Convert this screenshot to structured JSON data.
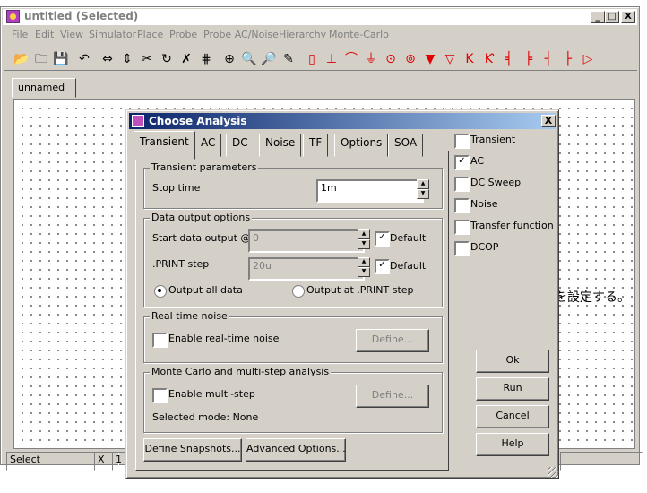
{
  "window": {
    "title": "untitled (Selected)",
    "caption_buttons": [
      "_",
      "□",
      "X"
    ]
  },
  "menu": [
    "File",
    "Edit",
    "View",
    "Simulator",
    "Place",
    "Probe",
    "Probe AC/Noise",
    "Hierarchy",
    "Monte-Carlo"
  ],
  "toolbar": {
    "items": [
      {
        "name": "open-folder-icon",
        "glyph": "📂"
      },
      {
        "name": "new-folder-icon",
        "glyph": "🗀"
      },
      {
        "name": "save-icon",
        "glyph": "💾"
      },
      {
        "name": "undo-icon",
        "glyph": "↶"
      },
      {
        "name": "mirror-icon",
        "glyph": "⇔"
      },
      {
        "name": "flip-icon",
        "glyph": "⇕"
      },
      {
        "name": "cut-icon",
        "glyph": "✂"
      },
      {
        "name": "rotate-icon",
        "glyph": "↻"
      },
      {
        "name": "delete-icon",
        "glyph": "✗"
      },
      {
        "name": "wire-icon",
        "glyph": "⋕"
      },
      {
        "name": "zoom-fit-icon",
        "glyph": "⊕"
      },
      {
        "name": "zoom-out-icon",
        "glyph": "🔍"
      },
      {
        "name": "zoom-in-icon",
        "glyph": "🔎"
      },
      {
        "name": "pencil-icon",
        "glyph": "✎"
      },
      {
        "name": "resistor-icon",
        "glyph": "▯"
      },
      {
        "name": "capacitor-icon",
        "glyph": "⊥"
      },
      {
        "name": "inductor-icon",
        "glyph": "⌒"
      },
      {
        "name": "ground-icon",
        "glyph": "⏚"
      },
      {
        "name": "voltage-source-icon",
        "glyph": "⊙"
      },
      {
        "name": "current-source-icon",
        "glyph": "⊚"
      },
      {
        "name": "diode-icon",
        "glyph": "▼"
      },
      {
        "name": "zener-icon",
        "glyph": "▽"
      },
      {
        "name": "npn-icon",
        "glyph": "K"
      },
      {
        "name": "pnp-icon",
        "glyph": "Ƙ"
      },
      {
        "name": "nmos-icon",
        "glyph": "╡"
      },
      {
        "name": "pmos-icon",
        "glyph": "╞"
      },
      {
        "name": "njfet-icon",
        "glyph": "┤"
      },
      {
        "name": "pjfet-icon",
        "glyph": "├"
      },
      {
        "name": "opamp-icon",
        "glyph": "▷"
      }
    ],
    "color": "#e00000"
  },
  "doc_tab": "unnamed",
  "canvas_text": "を設定する。",
  "status": {
    "mode": "Select",
    "x": "X",
    "x_val": "1"
  },
  "dialog": {
    "title": "Choose Analysis",
    "close": "X",
    "tabs": [
      "Transient",
      "AC",
      "DC",
      "Noise",
      "TF",
      "Options",
      "SOA"
    ],
    "transient": {
      "params_title": "Transient parameters",
      "stop_time_label": "Stop time",
      "stop_time_value": "1m",
      "output_title": "Data output options",
      "start_label": "Start data output @",
      "start_value": "0",
      "start_default_label": "Default",
      "print_label": ".PRINT step",
      "print_value": "20u",
      "print_default_label": "Default",
      "radio_all": "Output all data",
      "radio_print": "Output at .PRINT step",
      "noise_title": "Real time noise",
      "noise_check": "Enable real-time noise",
      "noise_define": "Define...",
      "mc_title": "Monte Carlo and multi-step analysis",
      "mc_check": "Enable multi-step",
      "mc_define": "Define...",
      "mc_mode": "Selected mode: None",
      "snapshots_btn": "Define Snapshots...",
      "advanced_btn": "Advanced Options..."
    },
    "analyses": [
      {
        "label": "Transient",
        "checked": false
      },
      {
        "label": "AC",
        "checked": true
      },
      {
        "label": "DC Sweep",
        "checked": false
      },
      {
        "label": "Noise",
        "checked": false
      },
      {
        "label": "Transfer function",
        "checked": false
      },
      {
        "label": "DCOP",
        "checked": false
      }
    ],
    "buttons": {
      "ok": "Ok",
      "run": "Run",
      "cancel": "Cancel",
      "help": "Help"
    }
  }
}
